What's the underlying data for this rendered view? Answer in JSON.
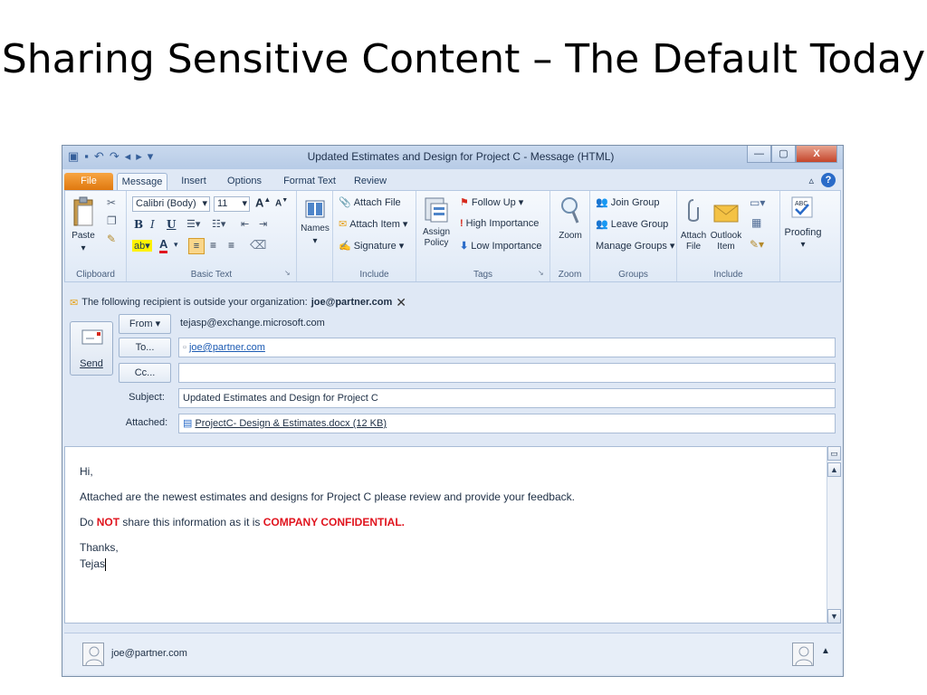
{
  "slide": {
    "title": "Sharing Sensitive Content – The Default Today"
  },
  "window": {
    "title": "Updated Estimates and Design for Project C  -  Message (HTML)",
    "controls": {
      "minimize": "—",
      "maximize": "▢",
      "close": "X"
    }
  },
  "tabs": {
    "file": "File",
    "message": "Message",
    "insert": "Insert",
    "options": "Options",
    "format_text": "Format Text",
    "review": "Review"
  },
  "ribbon": {
    "clipboard": {
      "paste": "Paste",
      "label": "Clipboard"
    },
    "basic_text": {
      "font_name": "Calibri (Body)",
      "font_size": "11",
      "label": "Basic Text"
    },
    "names": {
      "label": "Names"
    },
    "include": {
      "attach_file": "Attach File",
      "attach_item": "Attach Item",
      "signature": "Signature",
      "label": "Include"
    },
    "tags": {
      "assign_policy": "Assign Policy",
      "follow_up": "Follow Up",
      "high_importance": "High Importance",
      "low_importance": "Low Importance",
      "label": "Tags"
    },
    "zoom": {
      "zoom": "Zoom",
      "label": "Zoom"
    },
    "groups": {
      "join_group": "Join Group",
      "leave_group": "Leave Group",
      "manage_groups": "Manage Groups",
      "label": "Groups"
    },
    "include2": {
      "attach_file": "Attach File",
      "outlook_item": "Outlook Item",
      "label": "Include"
    },
    "proofing": {
      "label": "Proofing"
    }
  },
  "infobar": {
    "text": "The following recipient is outside your organization:",
    "recipient": "joe@partner.com"
  },
  "header": {
    "send": "Send",
    "from_button": "From",
    "from_value": "tejasp@exchange.microsoft.com",
    "to_button": "To...",
    "to_value": "joe@partner.com",
    "cc_button": "Cc...",
    "cc_value": "",
    "subject_label": "Subject:",
    "subject_value": "Updated Estimates and Design for Project C",
    "attached_label": "Attached:",
    "attachment": "ProjectC- Design & Estimates.docx (12 KB)"
  },
  "body": {
    "greeting": "Hi,",
    "line1": "Attached are the newest estimates and designs for Project C please review and provide your feedback.",
    "line2_a": "Do ",
    "line2_not": "NOT",
    "line2_b": " share this information as it is ",
    "line2_conf": "COMPANY CONFIDENTIAL.",
    "thanks": "Thanks,",
    "signature": "Tejas"
  },
  "people_pane": {
    "contact": "joe@partner.com"
  }
}
